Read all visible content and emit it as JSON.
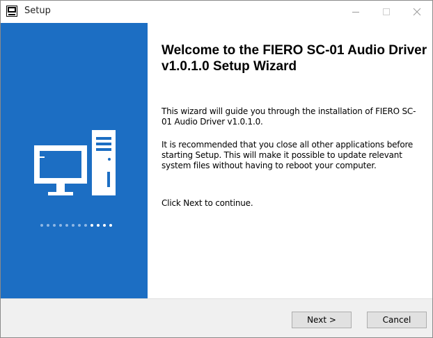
{
  "window": {
    "title": "Setup",
    "app_icon": "installer-icon",
    "controls": [
      "minimize-icon",
      "maximize-icon",
      "close-icon"
    ]
  },
  "banner": {
    "background_color": "#1c6ec3",
    "illustration": "desktop-computer-icon",
    "progress_dots_total": 12,
    "progress_dots_highlighted": 4
  },
  "main": {
    "heading": "Welcome to the FIERO SC-01 Audio Driver v1.0.1.0 Setup Wizard",
    "paragraph1": "This wizard will guide you through the installation of FIERO SC-01 Audio Driver v1.0.1.0.",
    "paragraph2": "It is recommended that you close all other applications before starting Setup. This will make it possible to update relevant system files without having to reboot your computer.",
    "paragraph3": "Click Next to continue."
  },
  "footer": {
    "next_label": "Next >",
    "cancel_label": "Cancel"
  }
}
